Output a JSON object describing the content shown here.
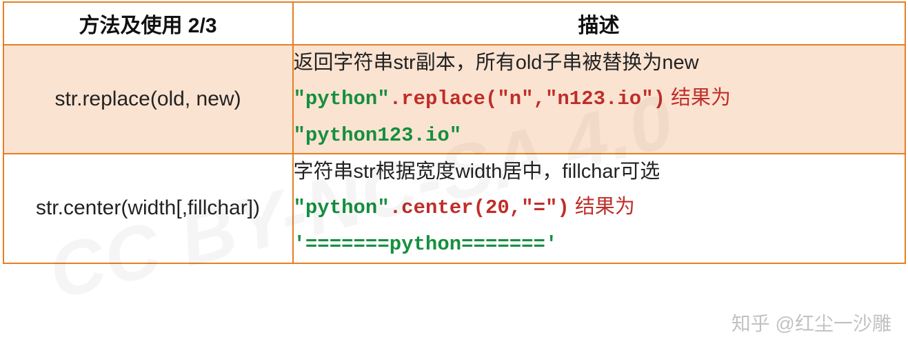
{
  "table": {
    "headers": {
      "method": "方法及使用 2/3",
      "desc": "描述"
    },
    "rows": [
      {
        "method": "str.replace(old, new)",
        "desc_line1": "返回字符串str副本，所有old子串被替换为new",
        "code_str": "\"python\"",
        "code_call": ".replace(\"n\",\"n123.io\")",
        "result_label": " 结果为",
        "result": "\"python123.io\""
      },
      {
        "method": "str.center(width[,fillchar])",
        "desc_line1": "字符串str根据宽度width居中，fillchar可选",
        "code_str": "\"python\"",
        "code_call": ".center(20,\"=\")",
        "result_label": " 结果为",
        "result": "'=======python======='"
      }
    ]
  },
  "watermarks": {
    "cc": "CC BY-NC-SA 4.0",
    "zhihu": "知乎 @红尘一沙雕"
  }
}
